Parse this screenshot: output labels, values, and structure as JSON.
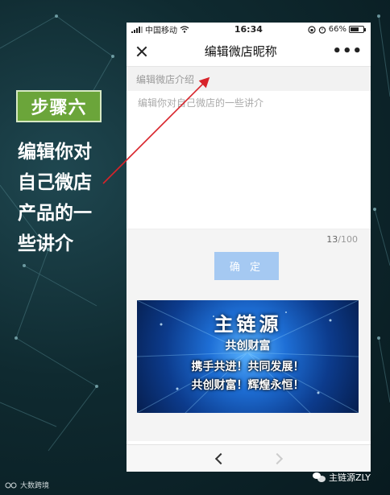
{
  "status_bar": {
    "carrier": "中国移动",
    "time": "16:34",
    "battery": "66%",
    "battery_level": 0.66
  },
  "title_bar": {
    "title": "编辑微店昵称",
    "more": "•••"
  },
  "intro_label": "编辑微店介绍",
  "textarea": {
    "placeholder": "编辑你对自己微店的一些讲介"
  },
  "counter": {
    "current": "13",
    "max": "/100"
  },
  "confirm_label": "确 定",
  "banner": {
    "line1": "主链源",
    "line2": "共创财富",
    "line3": "携手共进！共同发展！",
    "line4": "共创财富！辉煌永恒！"
  },
  "slide": {
    "step": "步骤六",
    "description": "编辑你对自己微店产品的一些讲介"
  },
  "branding": {
    "left": "大数跨境",
    "right": "主链源ZLY"
  },
  "colors": {
    "step_badge": "#6ba53a",
    "confirm_button": "#a5c9f2",
    "arrow": "#d8232a"
  }
}
